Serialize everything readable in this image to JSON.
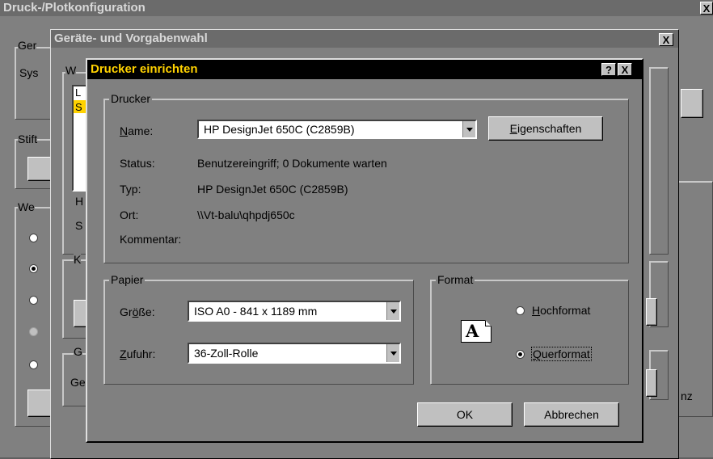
{
  "outer_window": {
    "title": "Druck-/Plotkonfiguration",
    "close": "X",
    "fragments": [
      "Ger",
      "Sys",
      "Stift",
      "We",
      "nz"
    ]
  },
  "mid_window": {
    "title": "Geräte- und Vorgabenwahl",
    "close": "X",
    "fragments": [
      "W",
      "L",
      "S",
      "H",
      "S",
      "K",
      "G",
      "Ge"
    ]
  },
  "dialog": {
    "title": "Drucker einrichten",
    "help": "?",
    "close": "X",
    "printer_group": "Drucker",
    "name_label": "Name:",
    "name_value": "HP DesignJet 650C (C2859B)",
    "properties_button": "Eigenschaften",
    "status_label": "Status:",
    "status_value": "Benutzereingriff; 0 Dokumente warten",
    "type_label": "Typ:",
    "type_value": "HP DesignJet 650C (C2859B)",
    "location_label": "Ort:",
    "location_value": "\\\\Vt-balu\\qhpdj650c",
    "comment_label": "Kommentar:",
    "comment_value": "",
    "paper_group": "Papier",
    "size_label": "Größe:",
    "size_value": "ISO A0 - 841 x 1189 mm",
    "source_label": "Zufuhr:",
    "source_value": "36-Zoll-Rolle",
    "format_group": "Format",
    "portrait_label": "Hochformat",
    "landscape_label": "Querformat",
    "orientation_selected": "Querformat",
    "ok_button": "OK",
    "cancel_button": "Abbrechen"
  },
  "colors": {
    "active_title_bg": "#000000",
    "active_title_text": "#ffd200",
    "dialog_bg": "#808080",
    "list_highlight": "#ffd200"
  }
}
